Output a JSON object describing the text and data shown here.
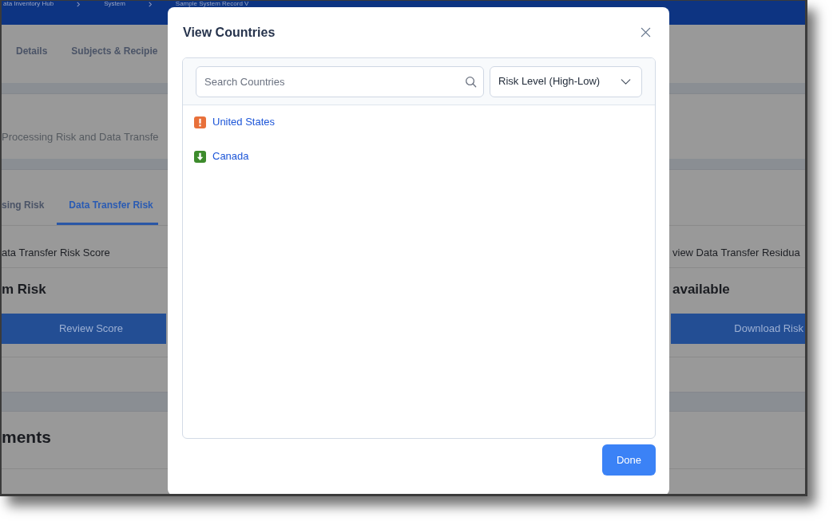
{
  "page": {
    "breadcrumb": [
      "ata Inventory Hub",
      "System",
      "Sample System Record V"
    ],
    "tabs": [
      {
        "label": "Details",
        "selected": false
      },
      {
        "label": "Subjects & Recipie",
        "selected": false
      }
    ],
    "subtitle": "Processing Risk and Data Transfe",
    "risk_tabs": [
      {
        "label": "sing Risk",
        "selected": false
      },
      {
        "label": "Data Transfer Risk",
        "selected": true
      }
    ],
    "score_cards": [
      {
        "label": "ata Transfer Risk Score",
        "value": "m Risk",
        "button": "Review Score"
      },
      {
        "label": "view Data Transfer Residua",
        "value": "available",
        "button": "Download Risk"
      }
    ],
    "section_heading": "ments"
  },
  "dialog": {
    "title": "View Countries",
    "search": {
      "placeholder": "Search Countries"
    },
    "sort": {
      "value": "Risk Level (High-Low)"
    },
    "countries": [
      {
        "name": "United States",
        "kind": "high",
        "color": "#e8703a"
      },
      {
        "name": "Canada",
        "kind": "low",
        "color": "#3d8b2c"
      }
    ],
    "done_button": "Done"
  }
}
